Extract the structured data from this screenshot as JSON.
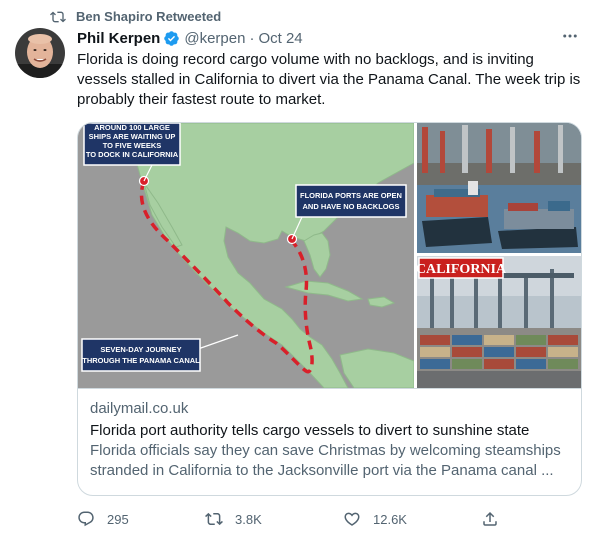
{
  "retweet": {
    "label": "Ben Shapiro Retweeted"
  },
  "tweet": {
    "author_name": "Phil Kerpen",
    "author_handle": "@kerpen",
    "separator": "·",
    "date": "Oct 24",
    "text": "Florida is doing record cargo volume with no backlogs, and is inviting vessels stalled in California to divert via the Panama Canal.  The week trip is probably their fastest route to market.",
    "more_icon": "more-horizontal-icon"
  },
  "card": {
    "map_labels": {
      "california_line1": "AROUND 100 LARGE",
      "california_line2": "SHIPS ARE WAITING UP",
      "california_line3": "TO FIVE WEEKS",
      "california_line4": "TO DOCK IN CALIFORNIA",
      "florida_line1": "FLORIDA PORTS ARE OPEN",
      "florida_line2": "AND HAVE NO BACKLOGS",
      "journey_line1": "SEVEN-DAY JOURNEY",
      "journey_line2": "THROUGH THE PANAMA CANAL"
    },
    "photo_banner": "CALIFORNIA",
    "domain": "dailymail.co.uk",
    "title": "Florida port authority tells cargo vessels to divert to sunshine state",
    "description": "Florida officials say they can save Christmas by welcoming steamships stranded in California to the Jacksonville port via the Panama canal ..."
  },
  "actions": {
    "reply_count": "295",
    "retweet_count": "3.8K",
    "like_count": "12.6K"
  },
  "colors": {
    "text_primary": "#0f1419",
    "text_secondary": "#536471",
    "verified_blue": "#1d9bf0",
    "border": "#cfd9de",
    "map_land": "#a7cfa1",
    "map_sea": "#9a9a9a",
    "route_red": "#d8202a",
    "label_navy": "#1f3566"
  }
}
